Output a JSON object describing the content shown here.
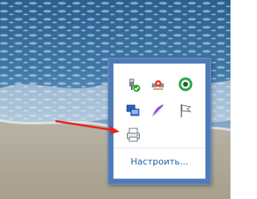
{
  "tray_popup": {
    "icons": [
      {
        "name": "usb-safely-remove-icon"
      },
      {
        "name": "network-alert-icon"
      },
      {
        "name": "green-ring-app-icon"
      },
      {
        "name": "monitors-display-icon"
      },
      {
        "name": "feather-pen-icon"
      },
      {
        "name": "action-center-flag-icon"
      },
      {
        "name": "printer-device-icon"
      }
    ],
    "customize_label": "Настроить..."
  },
  "annotation": {
    "arrow_color": "#e8221b"
  }
}
